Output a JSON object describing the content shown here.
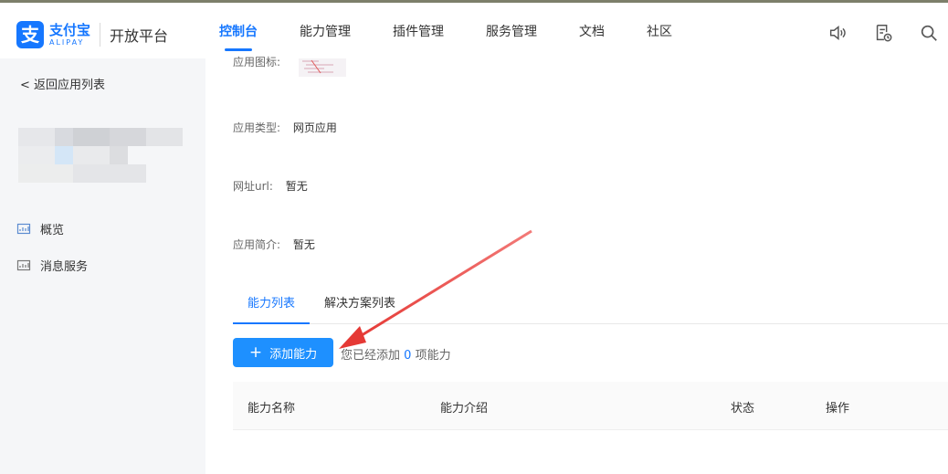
{
  "header": {
    "logo_badge": "支",
    "logo_cn": "支付宝",
    "logo_en": "ALIPAY",
    "platform": "开放平台",
    "nav": [
      {
        "label": "控制台",
        "active": true
      },
      {
        "label": "能力管理"
      },
      {
        "label": "插件管理"
      },
      {
        "label": "服务管理"
      },
      {
        "label": "文档"
      },
      {
        "label": "社区"
      }
    ],
    "icons": [
      "volume-icon",
      "document-clock-icon",
      "search-icon"
    ]
  },
  "sidebar": {
    "back_label": "返回应用列表",
    "items": [
      {
        "label": "概览",
        "icon": "chart-icon"
      },
      {
        "label": "消息服务",
        "icon": "chart-icon"
      }
    ]
  },
  "main": {
    "fields": [
      {
        "label": "应用图标:",
        "value": ""
      },
      {
        "label": "应用类型:",
        "value": "网页应用"
      },
      {
        "label": "网址url:",
        "value": "暂无"
      },
      {
        "label": "应用简介:",
        "value": "暂无"
      }
    ],
    "tabs": [
      {
        "label": "能力列表",
        "active": true
      },
      {
        "label": "解决方案列表"
      }
    ],
    "add_button": "添加能力",
    "count_prefix": "您已经添加",
    "count_value": "0",
    "count_suffix": "项能力",
    "table_headers": [
      "能力名称",
      "能力介绍",
      "状态",
      "操作"
    ]
  },
  "colors": {
    "accent": "#1677ff",
    "button": "#1e90ff",
    "arrow": "#e53935"
  }
}
